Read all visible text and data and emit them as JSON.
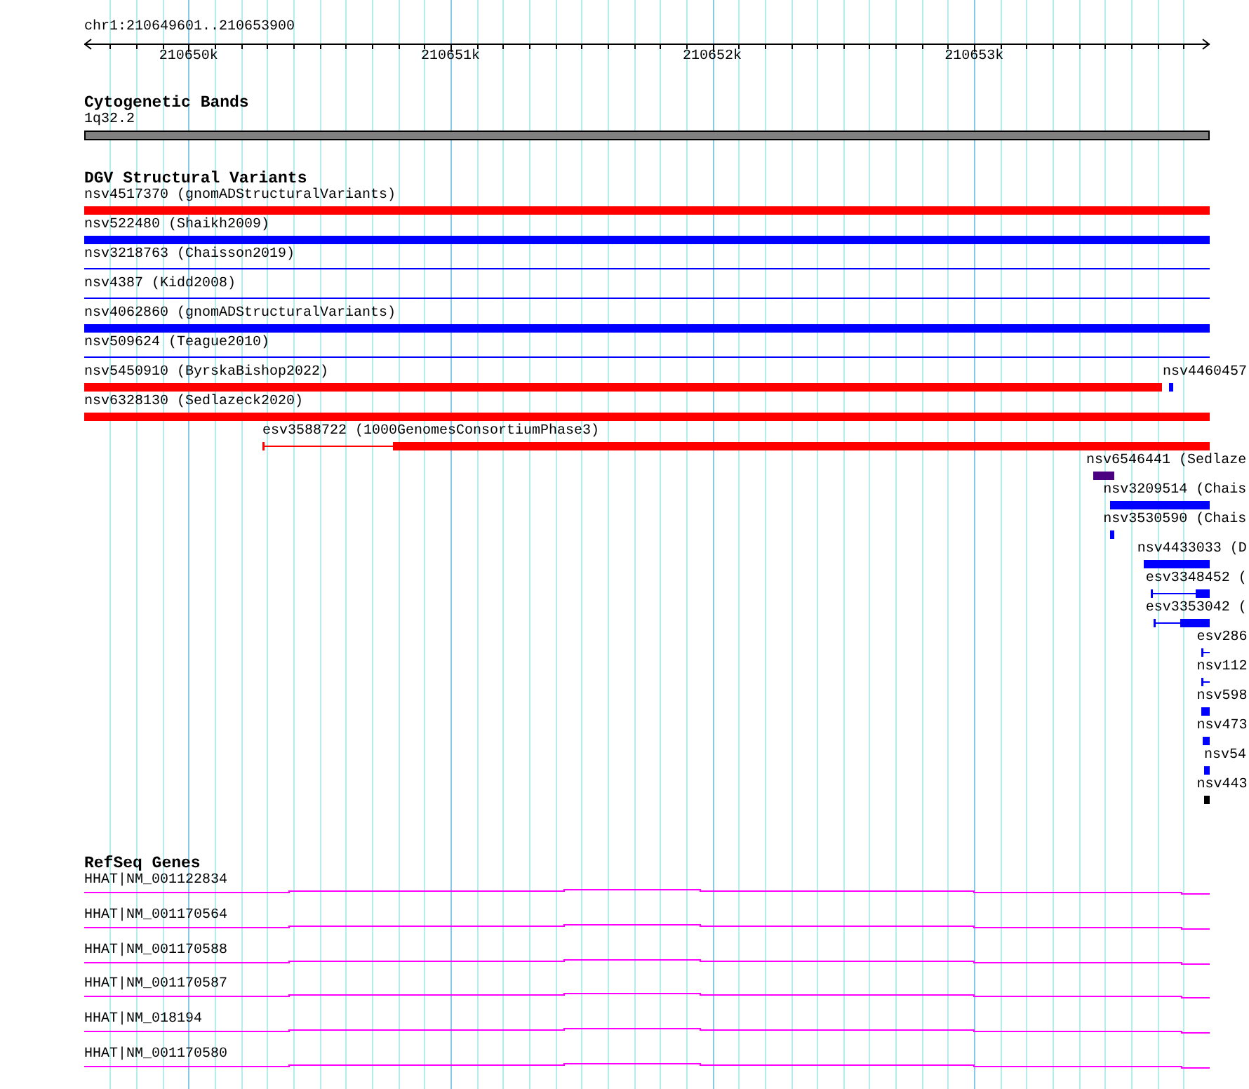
{
  "ruler": {
    "location": "chr1:210649601..210653900",
    "ticks": [
      "210650k",
      "210651k",
      "210652k",
      "210653k"
    ]
  },
  "tracks": [
    {
      "title": "Cytogenetic Bands",
      "kind": "bands",
      "features": [
        {
          "label": "1q32.2"
        }
      ]
    },
    {
      "title": "DGV Structural Variants",
      "kind": "variants",
      "features": [
        {
          "label": "nsv4517370 (gnomADStructuralVariants)",
          "color": "#ff0000",
          "kind": "bar"
        },
        {
          "label": "nsv522480 (Shaikh2009)",
          "color": "#0000ff",
          "kind": "bar"
        },
        {
          "label": "nsv3218763 (Chaisson2019)",
          "color": "#0000ff",
          "kind": "line"
        },
        {
          "label": "nsv4387 (Kidd2008)",
          "color": "#0000ff",
          "kind": "line"
        },
        {
          "label": "nsv4062860 (gnomADStructuralVariants)",
          "color": "#0000ff",
          "kind": "bar"
        },
        {
          "label": "nsv509624 (Teague2010)",
          "color": "#0000ff",
          "kind": "line"
        },
        {
          "label": "nsv5450910 (ByrskaBishop2022)",
          "color": "#ff0000",
          "kind": "bar"
        },
        {
          "label": "nsv4460457",
          "color": "#0000ff",
          "kind": "bar"
        },
        {
          "label": "nsv6328130 (Sedlazeck2020)",
          "color": "#ff0000",
          "kind": "bar"
        },
        {
          "label": "esv3588722 (1000GenomesConsortiumPhase3)",
          "color": "#ff0000",
          "kind": "split"
        },
        {
          "label": "nsv6546441 (Sedlaze",
          "color": "#4b0082",
          "kind": "bar"
        },
        {
          "label": "nsv3209514 (Chais",
          "color": "#0000ff",
          "kind": "bar"
        },
        {
          "label": "nsv3530590 (Chais",
          "color": "#0000ff",
          "kind": "bar"
        },
        {
          "label": "nsv4433033 (D",
          "color": "#0000ff",
          "kind": "bar"
        },
        {
          "label": "esv3348452 (",
          "color": "#0000ff",
          "kind": "split"
        },
        {
          "label": "esv3353042 (",
          "color": "#0000ff",
          "kind": "split"
        },
        {
          "label": "esv286",
          "color": "#0000ff",
          "kind": "split"
        },
        {
          "label": "nsv112",
          "color": "#0000ff",
          "kind": "split"
        },
        {
          "label": "nsv598",
          "color": "#0000ff",
          "kind": "bar"
        },
        {
          "label": "nsv473",
          "color": "#0000ff",
          "kind": "bar"
        },
        {
          "label": "nsv54",
          "color": "#0000ff",
          "kind": "bar"
        },
        {
          "label": "nsv443",
          "color": "#000000",
          "kind": "bar"
        }
      ]
    },
    {
      "title": "RefSeq Genes",
      "kind": "genes",
      "features": [
        {
          "label": "HHAT|NM_001122834"
        },
        {
          "label": "HHAT|NM_001170564"
        },
        {
          "label": "HHAT|NM_001170588"
        },
        {
          "label": "HHAT|NM_001170587"
        },
        {
          "label": "HHAT|NM_018194"
        },
        {
          "label": "HHAT|NM_001170580"
        }
      ]
    }
  ]
}
